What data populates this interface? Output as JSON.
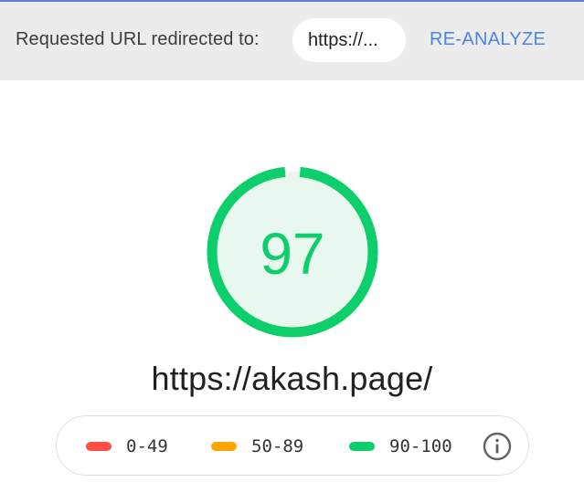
{
  "redirect": {
    "label": "Requested URL redirected to:",
    "url_chip": "https://...",
    "reanalyze_label": "RE-ANALYZE"
  },
  "score": {
    "value": "97",
    "fraction": 0.97,
    "color": "#0cce6b",
    "fill_color": "#e8f8ee"
  },
  "page_url": "https://akash.page/",
  "legend": {
    "items": [
      {
        "range": "0-49",
        "color": "#ff4e42"
      },
      {
        "range": "50-89",
        "color": "#ffa400"
      },
      {
        "range": "90-100",
        "color": "#0cce6b"
      }
    ],
    "info_icon": "info-icon"
  },
  "colors": {
    "accent_blue": "#4a86e8",
    "bar_background": "#ececec"
  }
}
